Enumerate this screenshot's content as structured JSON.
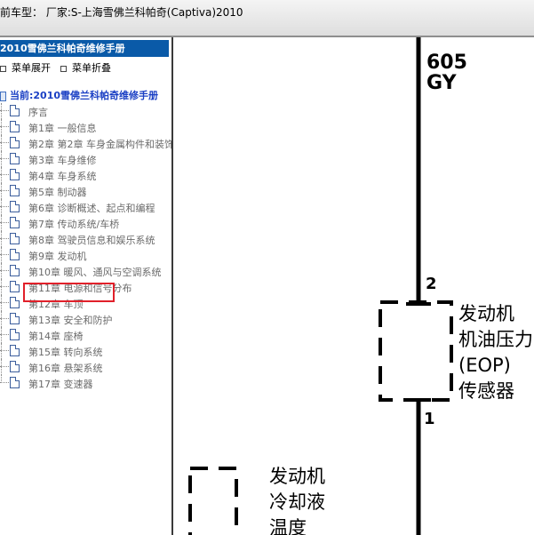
{
  "titlebar": {
    "text": "前车型：  厂家:S-上海雪佛兰科帕奇(Captiva)2010"
  },
  "left_panel": {
    "header": "2010雪佛兰科帕奇维修手册",
    "expand_label": "菜单展开",
    "collapse_label": "菜单折叠",
    "root_label": "当前:2010雪佛兰科帕奇维修手册",
    "tree_items": [
      {
        "label": "序言"
      },
      {
        "label": "第1章 一般信息"
      },
      {
        "label": "第2章 第2章 车身金属构件和装饰"
      },
      {
        "label": "第3章 车身维修"
      },
      {
        "label": "第4章 车身系统"
      },
      {
        "label": "第5章 制动器"
      },
      {
        "label": "第6章 诊断概述、起点和编程"
      },
      {
        "label": "第7章 传动系统/车桥"
      },
      {
        "label": "第8章 驾驶员信息和娱乐系统"
      },
      {
        "label": "第9章 发动机"
      },
      {
        "label": "第10章 暖风、通风与空调系统"
      },
      {
        "label": "第11章 电源和信号分布"
      },
      {
        "label": "第12章 车顶"
      },
      {
        "label": "第13章 安全和防护"
      },
      {
        "label": "第14章 座椅"
      },
      {
        "label": "第15章 转向系统"
      },
      {
        "label": "第16章 悬架系统"
      },
      {
        "label": "第17章 变速器"
      }
    ]
  },
  "diagram": {
    "wire_number": "605",
    "wire_color": "GY",
    "pin_top": "2",
    "pin_bottom": "1",
    "sensor1_lines": [
      "发动机",
      "机油压力",
      "(EOP)",
      "传感器"
    ],
    "sensor2_lines": [
      "发动机",
      "冷却液",
      "温度"
    ]
  }
}
